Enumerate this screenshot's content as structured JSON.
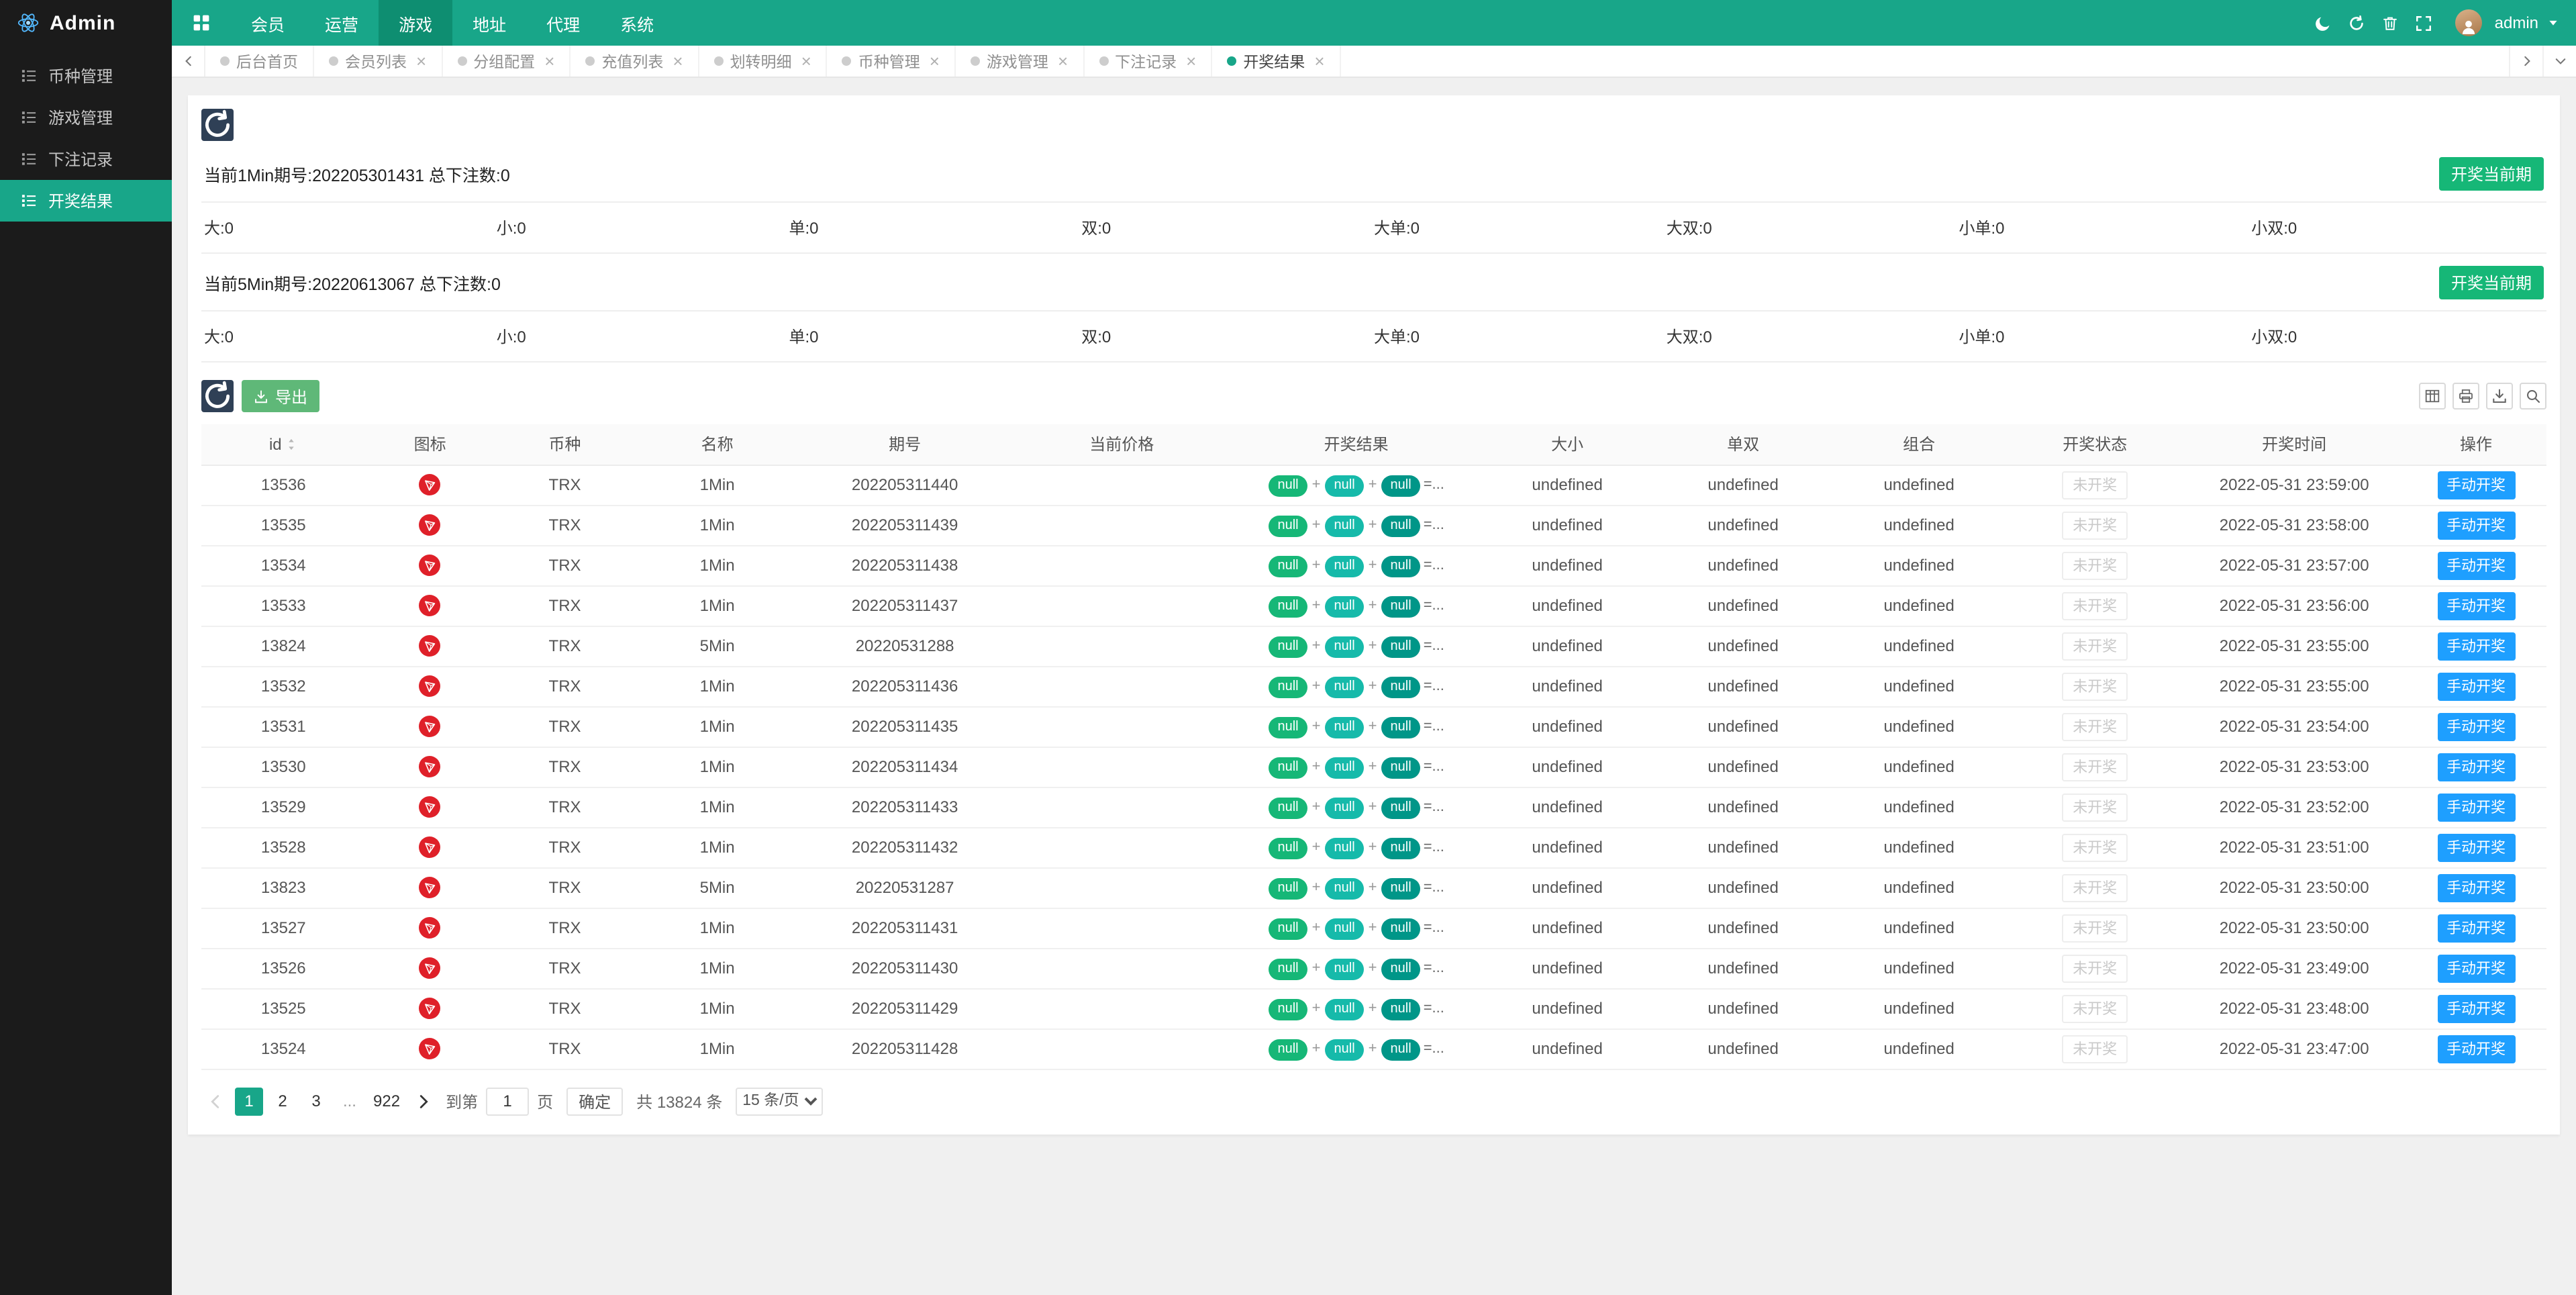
{
  "colors": {
    "primary": "#18a689",
    "nav_active": "#0e8e71",
    "green": "#16b777",
    "teal": "#16baaa",
    "dark_teal": "#009688",
    "blue": "#1e9fff",
    "export_green": "#5fb878",
    "dark_button": "#2f4056",
    "tron_red": "#df2029"
  },
  "brand": {
    "title": "Admin",
    "logo_icon": "atom-icon"
  },
  "navbar": {
    "menus": [
      {
        "name": "home",
        "label": "",
        "icon": "apps-icon",
        "active": false
      },
      {
        "name": "member",
        "label": "会员",
        "active": false
      },
      {
        "name": "operation",
        "label": "运营",
        "active": false
      },
      {
        "name": "game",
        "label": "游戏",
        "active": true
      },
      {
        "name": "address",
        "label": "地址",
        "active": false
      },
      {
        "name": "agent",
        "label": "代理",
        "active": false
      },
      {
        "name": "system",
        "label": "系统",
        "active": false
      }
    ],
    "actions": [
      {
        "name": "theme",
        "icon": "moon-icon"
      },
      {
        "name": "refresh",
        "icon": "refresh-icon"
      },
      {
        "name": "clear-cache",
        "icon": "trash-icon"
      },
      {
        "name": "fullscreen",
        "icon": "fullscreen-icon"
      }
    ],
    "user": {
      "name": "admin",
      "avatar_icon": "user-icon",
      "caret_icon": "caret-down-icon"
    }
  },
  "sidebar": {
    "items": [
      {
        "label": "币种管理",
        "icon": "list-icon",
        "active": false
      },
      {
        "label": "游戏管理",
        "icon": "list-icon",
        "active": false
      },
      {
        "label": "下注记录",
        "icon": "list-icon",
        "active": false
      },
      {
        "label": "开奖结果",
        "icon": "list-icon",
        "active": true
      }
    ]
  },
  "tabs": [
    {
      "label": "后台首页",
      "closable": false,
      "active": false
    },
    {
      "label": "会员列表",
      "closable": true,
      "active": false
    },
    {
      "label": "分组配置",
      "closable": true,
      "active": false
    },
    {
      "label": "充值列表",
      "closable": true,
      "active": false
    },
    {
      "label": "划转明细",
      "closable": true,
      "active": false
    },
    {
      "label": "币种管理",
      "closable": true,
      "active": false
    },
    {
      "label": "游戏管理",
      "closable": true,
      "active": false
    },
    {
      "label": "下注记录",
      "closable": true,
      "active": false
    },
    {
      "label": "开奖结果",
      "closable": true,
      "active": true
    }
  ],
  "panel": {
    "periods": [
      {
        "text": "当前1Min期号:202205301431 总下注数:0",
        "button": "开奖当前期",
        "stats": [
          "大:0",
          "小:0",
          "单:0",
          "双:0",
          "大单:0",
          "大双:0",
          "小单:0",
          "小双:0"
        ]
      },
      {
        "text": "当前5Min期号:20220613067 总下注数:0",
        "button": "开奖当前期",
        "stats": [
          "大:0",
          "小:0",
          "单:0",
          "双:0",
          "大单:0",
          "大双:0",
          "小单:0",
          "小双:0"
        ]
      }
    ],
    "toolbar": {
      "export_label": "导出",
      "icons": [
        {
          "name": "columns-filter",
          "icon": "columns-icon"
        },
        {
          "name": "print",
          "icon": "print-icon"
        },
        {
          "name": "export-file",
          "icon": "download-icon"
        },
        {
          "name": "search",
          "icon": "search-icon"
        }
      ]
    },
    "table": {
      "columns": [
        "id",
        "图标",
        "币种",
        "名称",
        "期号",
        "当前价格",
        "开奖结果",
        "大小",
        "单双",
        "组合",
        "开奖状态",
        "开奖时间",
        "操作"
      ],
      "result_pills": [
        "null",
        "null",
        "null"
      ],
      "result_suffix": "=...",
      "rows": [
        {
          "id": "13536",
          "coin": "TRX",
          "name": "1Min",
          "period": "202205311440",
          "price": "",
          "size": "undefined",
          "odd_even": "undefined",
          "combo": "undefined",
          "status": "未开奖",
          "time": "2022-05-31 23:59:00",
          "action": "手动开奖"
        },
        {
          "id": "13535",
          "coin": "TRX",
          "name": "1Min",
          "period": "202205311439",
          "price": "",
          "size": "undefined",
          "odd_even": "undefined",
          "combo": "undefined",
          "status": "未开奖",
          "time": "2022-05-31 23:58:00",
          "action": "手动开奖"
        },
        {
          "id": "13534",
          "coin": "TRX",
          "name": "1Min",
          "period": "202205311438",
          "price": "",
          "size": "undefined",
          "odd_even": "undefined",
          "combo": "undefined",
          "status": "未开奖",
          "time": "2022-05-31 23:57:00",
          "action": "手动开奖"
        },
        {
          "id": "13533",
          "coin": "TRX",
          "name": "1Min",
          "period": "202205311437",
          "price": "",
          "size": "undefined",
          "odd_even": "undefined",
          "combo": "undefined",
          "status": "未开奖",
          "time": "2022-05-31 23:56:00",
          "action": "手动开奖"
        },
        {
          "id": "13824",
          "coin": "TRX",
          "name": "5Min",
          "period": "20220531288",
          "price": "",
          "size": "undefined",
          "odd_even": "undefined",
          "combo": "undefined",
          "status": "未开奖",
          "time": "2022-05-31 23:55:00",
          "action": "手动开奖"
        },
        {
          "id": "13532",
          "coin": "TRX",
          "name": "1Min",
          "period": "202205311436",
          "price": "",
          "size": "undefined",
          "odd_even": "undefined",
          "combo": "undefined",
          "status": "未开奖",
          "time": "2022-05-31 23:55:00",
          "action": "手动开奖"
        },
        {
          "id": "13531",
          "coin": "TRX",
          "name": "1Min",
          "period": "202205311435",
          "price": "",
          "size": "undefined",
          "odd_even": "undefined",
          "combo": "undefined",
          "status": "未开奖",
          "time": "2022-05-31 23:54:00",
          "action": "手动开奖"
        },
        {
          "id": "13530",
          "coin": "TRX",
          "name": "1Min",
          "period": "202205311434",
          "price": "",
          "size": "undefined",
          "odd_even": "undefined",
          "combo": "undefined",
          "status": "未开奖",
          "time": "2022-05-31 23:53:00",
          "action": "手动开奖"
        },
        {
          "id": "13529",
          "coin": "TRX",
          "name": "1Min",
          "period": "202205311433",
          "price": "",
          "size": "undefined",
          "odd_even": "undefined",
          "combo": "undefined",
          "status": "未开奖",
          "time": "2022-05-31 23:52:00",
          "action": "手动开奖"
        },
        {
          "id": "13528",
          "coin": "TRX",
          "name": "1Min",
          "period": "202205311432",
          "price": "",
          "size": "undefined",
          "odd_even": "undefined",
          "combo": "undefined",
          "status": "未开奖",
          "time": "2022-05-31 23:51:00",
          "action": "手动开奖"
        },
        {
          "id": "13823",
          "coin": "TRX",
          "name": "5Min",
          "period": "20220531287",
          "price": "",
          "size": "undefined",
          "odd_even": "undefined",
          "combo": "undefined",
          "status": "未开奖",
          "time": "2022-05-31 23:50:00",
          "action": "手动开奖"
        },
        {
          "id": "13527",
          "coin": "TRX",
          "name": "1Min",
          "period": "202205311431",
          "price": "",
          "size": "undefined",
          "odd_even": "undefined",
          "combo": "undefined",
          "status": "未开奖",
          "time": "2022-05-31 23:50:00",
          "action": "手动开奖"
        },
        {
          "id": "13526",
          "coin": "TRX",
          "name": "1Min",
          "period": "202205311430",
          "price": "",
          "size": "undefined",
          "odd_even": "undefined",
          "combo": "undefined",
          "status": "未开奖",
          "time": "2022-05-31 23:49:00",
          "action": "手动开奖"
        },
        {
          "id": "13525",
          "coin": "TRX",
          "name": "1Min",
          "period": "202205311429",
          "price": "",
          "size": "undefined",
          "odd_even": "undefined",
          "combo": "undefined",
          "status": "未开奖",
          "time": "2022-05-31 23:48:00",
          "action": "手动开奖"
        },
        {
          "id": "13524",
          "coin": "TRX",
          "name": "1Min",
          "period": "202205311428",
          "price": "",
          "size": "undefined",
          "odd_even": "undefined",
          "combo": "undefined",
          "status": "未开奖",
          "time": "2022-05-31 23:47:00",
          "action": "手动开奖"
        }
      ]
    },
    "pagination": {
      "pages": [
        "1",
        "2",
        "3",
        "...",
        "922"
      ],
      "active_page": "1",
      "skip_prefix": "到第",
      "skip_value": "1",
      "skip_suffix": "页",
      "confirm_label": "确定",
      "total_label": "共 13824 条",
      "page_size_label": "15 条/页"
    }
  }
}
